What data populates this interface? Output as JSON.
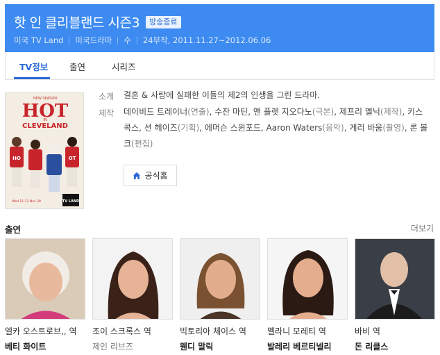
{
  "header": {
    "title": "핫 인 클리블랜드 시즌3",
    "badge": "방송종료",
    "meta": [
      "미국 TV Land",
      "미국드라마",
      "수",
      "24부작, 2011.11.27~2012.06.06"
    ]
  },
  "tabs": [
    {
      "label": "TV정보",
      "active": true
    },
    {
      "label": "출연",
      "active": false
    },
    {
      "label": "시리즈",
      "active": false
    }
  ],
  "poster": {
    "top_text": "NEW SEASON",
    "hot": "HOT",
    "in": "IN",
    "city": "CLEVELAND",
    "airtime": "Wed 11-11 Nov 30",
    "network": "TV LAND"
  },
  "info": {
    "intro_label": "소개",
    "intro": "결혼 & 사랑에 실패한 이들의 제2의 인생을 그린 드라마.",
    "production_label": "제작",
    "production": [
      {
        "name": "데이비드 트레이너",
        "role": "(연출)"
      },
      {
        "name": "수잔 마틴",
        "role": ""
      },
      {
        "name": "앤 플렛 지오다노",
        "role": "(극본)"
      },
      {
        "name": "제프리 멜닉",
        "role": "(제작)"
      },
      {
        "name": "키스 콕스",
        "role": ""
      },
      {
        "name": "션 헤이즈",
        "role": "(기획)"
      },
      {
        "name": "에머슨 스윈포드",
        "role": ""
      },
      {
        "name": "Aaron Waters",
        "role": "(음악)"
      },
      {
        "name": "게리 바움",
        "role": "(촬영)"
      },
      {
        "name": "론 볼크",
        "role": "(편집)"
      }
    ],
    "home_button": "공식홈"
  },
  "cast_section": {
    "title": "출연",
    "more": "더보기",
    "members": [
      {
        "role": "엘카 오스트로브,, 역",
        "name": "베티 화이트",
        "bold": true
      },
      {
        "role": "조이 스크록스 역",
        "name": "제인 리브즈",
        "bold": false
      },
      {
        "role": "빅토리아 체이스 역",
        "name": "웬디 말릭",
        "bold": true
      },
      {
        "role": "멜라니 모레티 역",
        "name": "발레리 베르티넬리",
        "bold": true
      },
      {
        "role": "바비 역",
        "name": "돈 리클스",
        "bold": true
      }
    ]
  },
  "colors": {
    "header_bg": "#3d8bf0",
    "active_tab": "#2a6ad8"
  }
}
